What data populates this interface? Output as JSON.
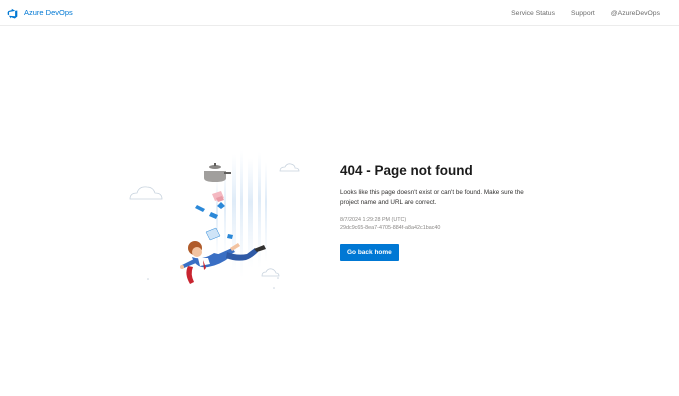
{
  "header": {
    "brand_label": "Azure DevOps",
    "nav": {
      "service_status": "Service Status",
      "support": "Support",
      "twitter": "@AzureDevOps"
    }
  },
  "error": {
    "title": "404 - Page not found",
    "description": "Looks like this page doesn't exist or can't be found. Make sure the project name and URL are correct.",
    "timestamp": "8/7/2024 1:29:28 PM (UTC)",
    "activity_id": "29dc9c65-8ea7-4705-884f-a8a42c1bac40",
    "go_back_label": "Go back home"
  },
  "colors": {
    "accent": "#0078d4",
    "title_text": "#1b1b1b",
    "muted_text": "#8a8886"
  },
  "icons": {
    "brand": "azure-devops-logo-icon",
    "illustration": "falling-person-404-illustration"
  }
}
